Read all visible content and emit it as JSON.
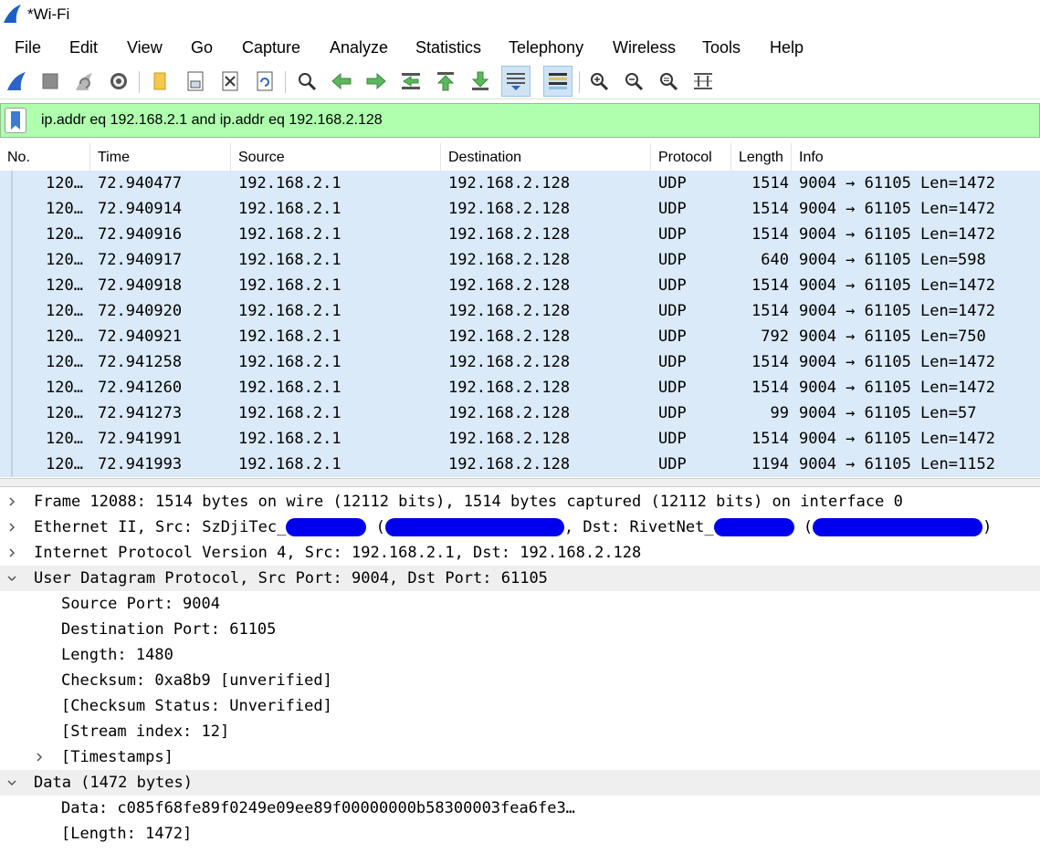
{
  "window": {
    "title": "*Wi-Fi"
  },
  "menu": [
    "File",
    "Edit",
    "View",
    "Go",
    "Capture",
    "Analyze",
    "Statistics",
    "Telephony",
    "Wireless",
    "Tools",
    "Help"
  ],
  "toolbar": {
    "icons": [
      "shark-fin-start-icon",
      "stop-capture-icon",
      "restart-capture-icon",
      "capture-options-icon",
      "open-file-icon",
      "save-file-icon",
      "close-file-icon",
      "reload-file-icon",
      "find-packet-icon",
      "go-back-icon",
      "go-forward-icon",
      "go-to-packet-icon",
      "first-packet-icon",
      "last-packet-icon",
      "auto-scroll-icon",
      "colorize-icon",
      "zoom-in-icon",
      "zoom-out-icon",
      "normal-size-icon",
      "resize-columns-icon"
    ]
  },
  "filter": {
    "value": "ip.addr eq 192.168.2.1 and ip.addr eq 192.168.2.128",
    "background": "#afffaf"
  },
  "packet_list": {
    "columns": [
      "No.",
      "Time",
      "Source",
      "Destination",
      "Protocol",
      "Length",
      "Info"
    ],
    "rows": [
      {
        "no": "120…",
        "time": "72.940477",
        "src": "192.168.2.1",
        "dst": "192.168.2.128",
        "proto": "UDP",
        "len": "1514",
        "info": "9004 → 61105 Len=1472"
      },
      {
        "no": "120…",
        "time": "72.940914",
        "src": "192.168.2.1",
        "dst": "192.168.2.128",
        "proto": "UDP",
        "len": "1514",
        "info": "9004 → 61105 Len=1472"
      },
      {
        "no": "120…",
        "time": "72.940916",
        "src": "192.168.2.1",
        "dst": "192.168.2.128",
        "proto": "UDP",
        "len": "1514",
        "info": "9004 → 61105 Len=1472"
      },
      {
        "no": "120…",
        "time": "72.940917",
        "src": "192.168.2.1",
        "dst": "192.168.2.128",
        "proto": "UDP",
        "len": "640",
        "info": "9004 → 61105 Len=598"
      },
      {
        "no": "120…",
        "time": "72.940918",
        "src": "192.168.2.1",
        "dst": "192.168.2.128",
        "proto": "UDP",
        "len": "1514",
        "info": "9004 → 61105 Len=1472"
      },
      {
        "no": "120…",
        "time": "72.940920",
        "src": "192.168.2.1",
        "dst": "192.168.2.128",
        "proto": "UDP",
        "len": "1514",
        "info": "9004 → 61105 Len=1472"
      },
      {
        "no": "120…",
        "time": "72.940921",
        "src": "192.168.2.1",
        "dst": "192.168.2.128",
        "proto": "UDP",
        "len": "792",
        "info": "9004 → 61105 Len=750"
      },
      {
        "no": "120…",
        "time": "72.941258",
        "src": "192.168.2.1",
        "dst": "192.168.2.128",
        "proto": "UDP",
        "len": "1514",
        "info": "9004 → 61105 Len=1472"
      },
      {
        "no": "120…",
        "time": "72.941260",
        "src": "192.168.2.1",
        "dst": "192.168.2.128",
        "proto": "UDP",
        "len": "1514",
        "info": "9004 → 61105 Len=1472"
      },
      {
        "no": "120…",
        "time": "72.941273",
        "src": "192.168.2.1",
        "dst": "192.168.2.128",
        "proto": "UDP",
        "len": "99",
        "info": "9004 → 61105 Len=57"
      },
      {
        "no": "120…",
        "time": "72.941991",
        "src": "192.168.2.1",
        "dst": "192.168.2.128",
        "proto": "UDP",
        "len": "1514",
        "info": "9004 → 61105 Len=1472"
      },
      {
        "no": "120…",
        "time": "72.941993",
        "src": "192.168.2.1",
        "dst": "192.168.2.128",
        "proto": "UDP",
        "len": "1194",
        "info": "9004 → 61105 Len=1152"
      }
    ],
    "row_color": "#dbeaf8"
  },
  "details": {
    "frame": "Frame 12088: 1514 bytes on wire (12112 bits), 1514 bytes captured (12112 bits) on interface 0",
    "ethernet": {
      "prefix": "Ethernet II, Src: SzDjiTec_",
      "open_paren": "(",
      "dst_label": ", Dst: RivetNet_",
      "close_paren": ")"
    },
    "ip": "Internet Protocol Version 4, Src: 192.168.2.1, Dst: 192.168.2.128",
    "udp": "User Datagram Protocol, Src Port: 9004, Dst Port: 61105",
    "udp_fields": [
      "Source Port: 9004",
      "Destination Port: 61105",
      "Length: 1480",
      "Checksum: 0xa8b9 [unverified]",
      "[Checksum Status: Unverified]",
      "[Stream index: 12]"
    ],
    "timestamps": "[Timestamps]",
    "data": "Data (1472 bytes)",
    "data_fields": [
      "Data: c085f68fe89f0249e09ee89f00000000b58300003fea6fe3…",
      "[Length: 1472]"
    ],
    "redaction_color": "#0000ee"
  }
}
